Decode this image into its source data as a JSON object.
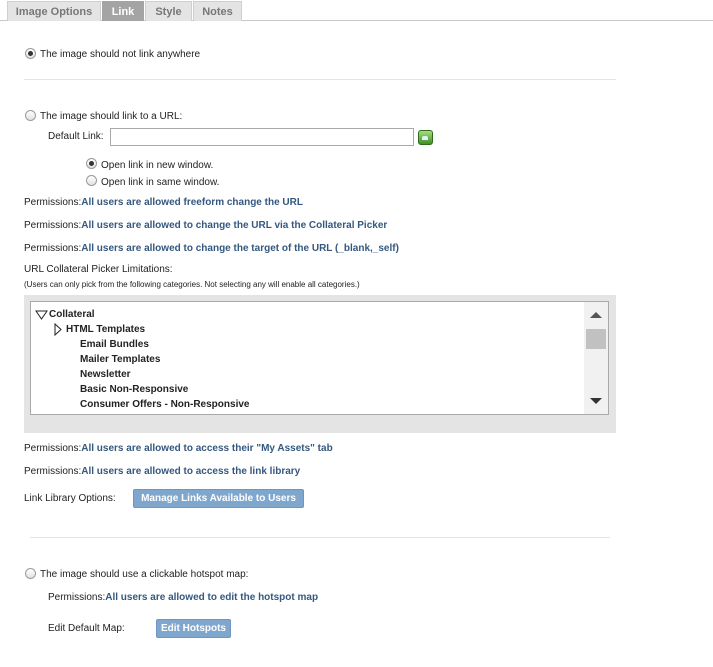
{
  "tabs": [
    "Image Options",
    "Link",
    "Style",
    "Notes"
  ],
  "no_link": {
    "label": "The image should not link anywhere"
  },
  "url_link": {
    "label": "The image should link to a URL:",
    "default_link_label": "Default Link:",
    "default_link_value": "",
    "open_new_label": "Open link in new window.",
    "open_same_label": "Open link in same window."
  },
  "permissions": {
    "prefix": "Permissions:",
    "freeform": "All users are allowed freeform change the URL",
    "collateral_picker": "All users are allowed to change the URL via the Collateral Picker",
    "target": "All users are allowed to change the target of the URL (_blank,_self)",
    "my_assets": "All users are allowed to access their \"My Assets\" tab",
    "link_library": "All users are allowed to access the link library"
  },
  "picker": {
    "title": "URL Collateral Picker Limitations:",
    "note": "(Users can only pick from the following categories. Not selecting any will enable all categories.)",
    "tree": [
      "Collateral",
      "HTML Templates",
      "Email Bundles",
      "Mailer Templates",
      "Newsletter",
      "Basic Non-Responsive",
      "Consumer Offers - Non-Responsive"
    ]
  },
  "link_library": {
    "label": "Link Library Options:",
    "button": "Manage Links Available to Users"
  },
  "hotspot": {
    "label": "The image should use a clickable hotspot map:",
    "permission": "All users are allowed to edit the hotspot map",
    "edit_label": "Edit Default Map:",
    "button": "Edit Hotspots"
  },
  "colors": {
    "link_text": "#34587f",
    "button_bg": "#7fa7ce",
    "active_tab": "#a4a4a4"
  },
  "icons": [
    "tree-expanded-triangle-icon",
    "tree-collapsed-triangle-icon",
    "green-picker-icon",
    "scroll-up-arrow-icon",
    "scroll-down-arrow-icon"
  ]
}
